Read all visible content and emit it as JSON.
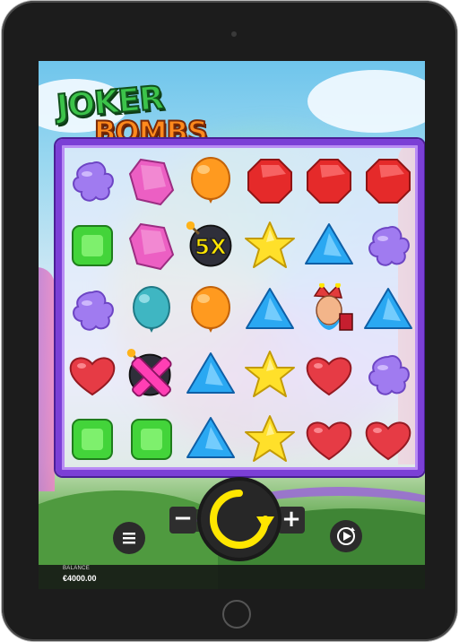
{
  "game": {
    "logo_line1": "JOKER",
    "logo_line2": "BOMBS"
  },
  "board": {
    "columns": 6,
    "rows": 5,
    "symbols": [
      [
        "purple-blob",
        "pink-gem",
        "orange-balloon",
        "red-octagon",
        "red-octagon",
        "red-octagon"
      ],
      [
        "green-square",
        "pink-gem",
        "bomb-5x",
        "yellow-star",
        "blue-triangle",
        "purple-blob"
      ],
      [
        "purple-blob",
        "teal-balloon",
        "orange-balloon",
        "blue-triangle",
        "joker-wild",
        "blue-triangle"
      ],
      [
        "red-heart",
        "bomb-cross",
        "blue-triangle",
        "yellow-star",
        "red-heart",
        "purple-blob"
      ],
      [
        "green-square",
        "green-square",
        "blue-triangle",
        "yellow-star",
        "red-heart",
        "red-heart"
      ]
    ],
    "multiplier_label": "5X"
  },
  "controls": {
    "minus_label": "−",
    "plus_label": "+",
    "menu_icon": "hamburger-menu-icon",
    "spin_icon": "spin-arrow-icon",
    "autoplay_icon": "autoplay-icon"
  },
  "balance": {
    "label": "BALANCE",
    "value": "€4000.00"
  },
  "colors": {
    "frame_purple": "#7b3fd6",
    "spin_yellow": "#ffe600",
    "background_sky": "#9bd8f0"
  }
}
